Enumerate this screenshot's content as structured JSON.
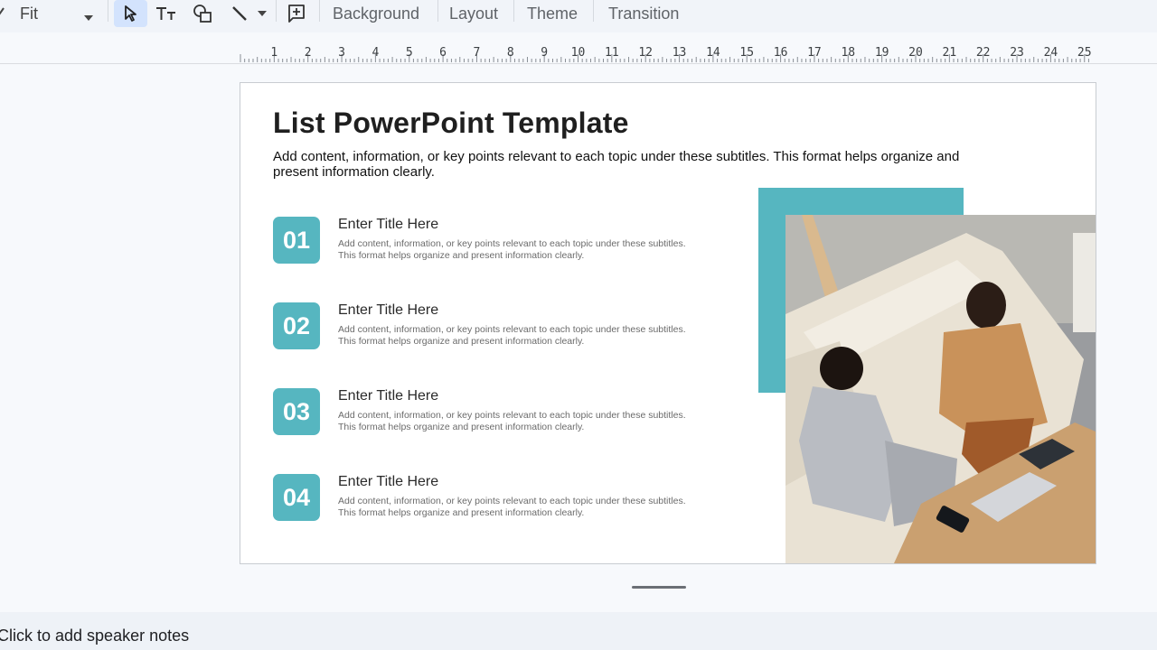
{
  "toolbar": {
    "zoom_value": "Fit",
    "menu_items": [
      "Background",
      "Layout",
      "Theme",
      "Transition"
    ],
    "icons": [
      "select-arrow-icon",
      "text-box-icon",
      "shapes-icon",
      "line-icon",
      "new-comment-icon"
    ]
  },
  "ruler": {
    "ticks": [
      "1",
      "2",
      "3",
      "4",
      "5",
      "6",
      "7",
      "8",
      "9",
      "10",
      "11",
      "12",
      "13",
      "14",
      "15",
      "16",
      "17",
      "18",
      "19",
      "20",
      "21",
      "22",
      "23",
      "24",
      "25"
    ]
  },
  "slide": {
    "title": "List PowerPoint Template",
    "subtitle": "Add content, information, or key points relevant to each topic under these subtitles. This format helps organize and present information clearly.",
    "items": [
      {
        "number": "01",
        "title": "Enter Title Here",
        "desc": "Add content, information, or key points relevant to each topic under these subtitles. This format helps organize and present information clearly."
      },
      {
        "number": "02",
        "title": "Enter Title Here",
        "desc": "Add content, information, or key points relevant to each topic under these subtitles. This format helps organize and present information clearly."
      },
      {
        "number": "03",
        "title": "Enter Title Here",
        "desc": "Add content, information, or key points relevant to each topic under these subtitles. This format helps organize and present information clearly."
      },
      {
        "number": "04",
        "title": "Enter Title Here",
        "desc": "Add content, information, or key points relevant to each topic under these subtitles. This format helps organize and present information clearly."
      }
    ],
    "accent_color": "#56b6c0"
  },
  "notes": {
    "placeholder": "Click to add speaker notes"
  }
}
